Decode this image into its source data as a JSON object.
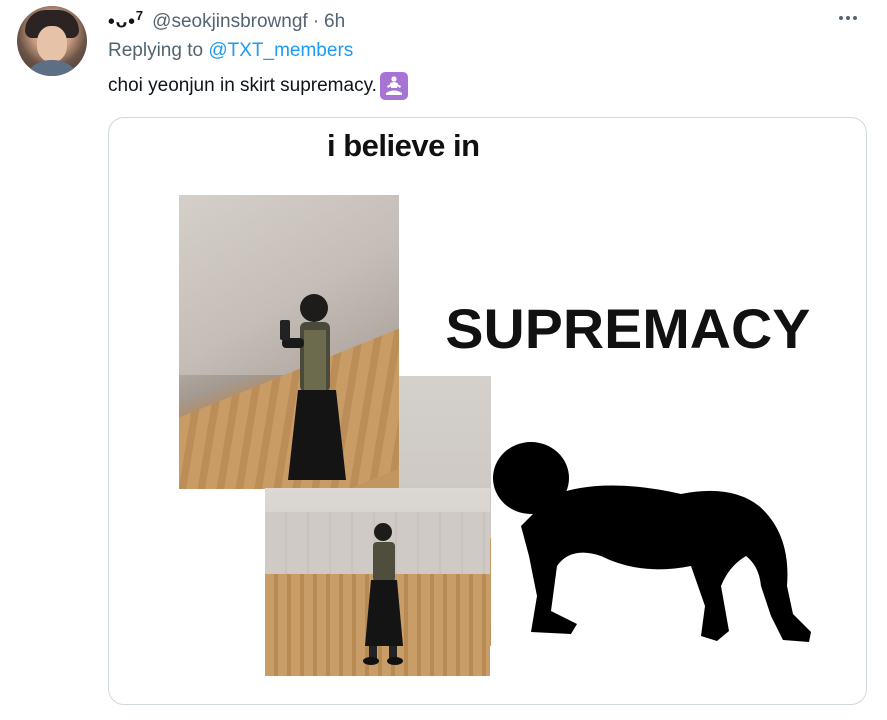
{
  "tweet": {
    "display_name": "•ᴗ•",
    "display_name_sup": "7",
    "handle": "@seokjinsbrowngf",
    "separator": "·",
    "time": "6h",
    "replying_prefix": "Replying to ",
    "replying_to": "@TXT_members",
    "text": "choi yeonjun in skirt supremacy.",
    "emoji_icon": "person-in-lotus-position-icon"
  },
  "media": {
    "meme_line1": "i believe in",
    "meme_big": "SUPREMACY",
    "silhouette_icon": "kneeling-person-silhouette"
  },
  "colors": {
    "link": "#1d9bf0",
    "secondary_text": "#536471",
    "emoji_bg": "#a874d4"
  }
}
